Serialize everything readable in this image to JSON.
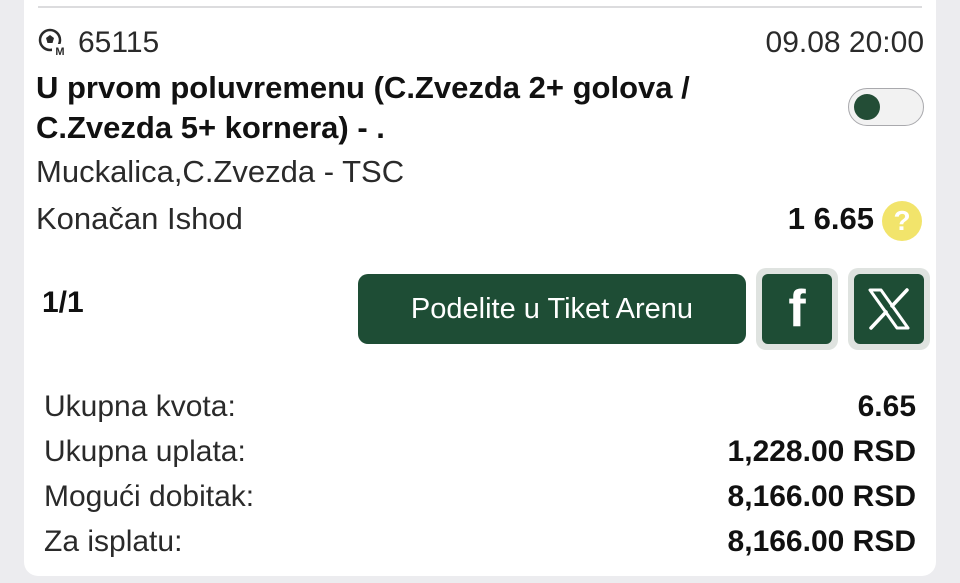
{
  "ticket": {
    "id": "65115",
    "datetime": "09.08 20:00",
    "title": "U prvom poluvremenu (C.Zvezda 2+ golova / C.Zvezda 5+ kornera) - .",
    "event": "Muckalica,C.Zvezda - TSC",
    "outcome_label": "Konačan Ishod",
    "outcome_odds": "1 6.65",
    "help_glyph": "?",
    "toggle_on": false
  },
  "pagination": "1/1",
  "share": {
    "arena_label": "Podelite u Tiket Arenu",
    "facebook_icon": "facebook-icon",
    "x_icon": "x-icon",
    "facebook_glyph": "f"
  },
  "summary": [
    {
      "label": "Ukupna kvota:",
      "value": "6.65"
    },
    {
      "label": "Ukupna uplata:",
      "value": "1,228.00 RSD"
    },
    {
      "label": "Mogući dobitak:",
      "value": "8,166.00 RSD"
    },
    {
      "label": "Za isplatu:",
      "value": "8,166.00 RSD"
    }
  ],
  "colors": {
    "accent": "#1e4d35",
    "help": "#f2e46b",
    "background": "#ececef",
    "card": "#ffffff"
  }
}
